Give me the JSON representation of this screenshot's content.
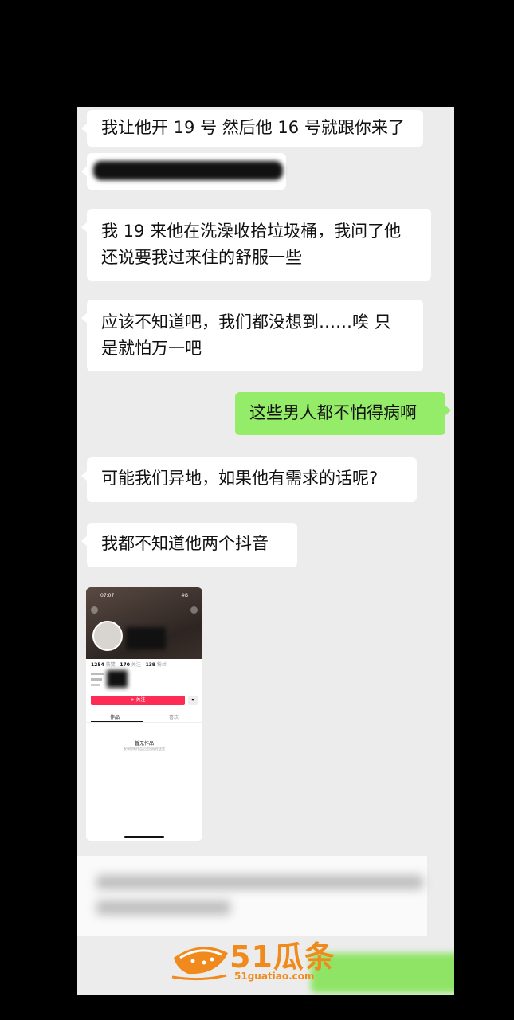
{
  "messages": [
    {
      "side": "in",
      "text": "我让他开 19 号 然后他 16 号就跟你来了"
    },
    {
      "side": "in",
      "lines": [
        "我 19 来他在洗澡收拾垃圾桶，我问了他",
        "还说要我过来住的舒服一些"
      ]
    },
    {
      "side": "in",
      "lines": [
        "应该不知道吧，我们都没想到……唉 只",
        "是就怕万一吧"
      ]
    },
    {
      "side": "out",
      "text": "这些男人都不怕得病啊"
    },
    {
      "side": "in",
      "text": "可能我们异地，如果他有需求的话呢?"
    },
    {
      "side": "in",
      "text": "我都不知道他两个抖音"
    }
  ],
  "screenshot": {
    "time": "07:07",
    "signal": "4G",
    "stats": [
      {
        "num": "1254",
        "label": "获赞"
      },
      {
        "num": "170",
        "label": "关注"
      },
      {
        "num": "139",
        "label": "粉丝"
      }
    ],
    "follow_label": "+ 关注",
    "tabs": [
      "作品",
      "喜欢"
    ],
    "empty_title": "暂无作品",
    "empty_sub": "发布你的作品后会出现在这里"
  },
  "watermark": {
    "brand": "51瓜条",
    "url": "51guatiao.com"
  }
}
